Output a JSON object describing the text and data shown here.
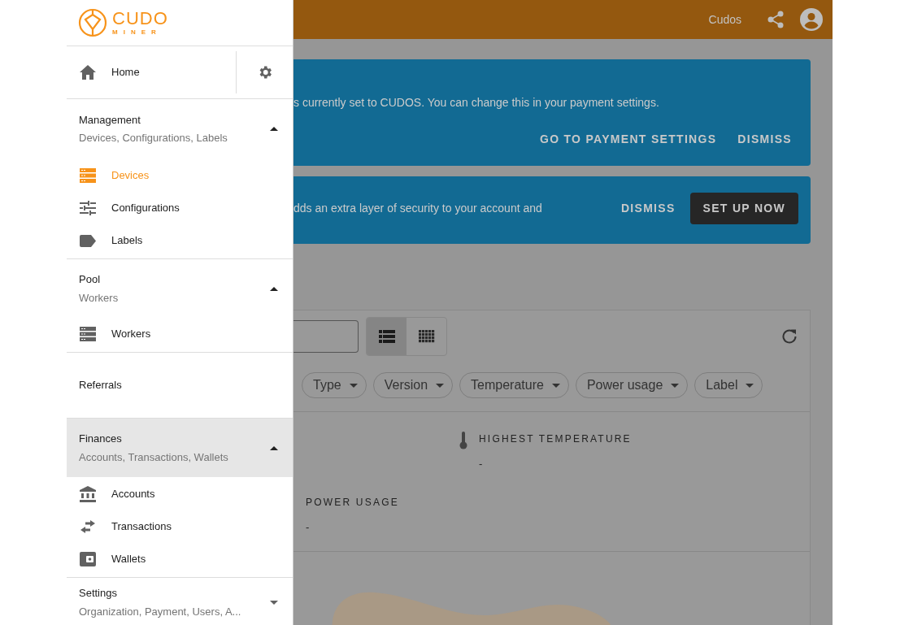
{
  "drawer": {
    "logo": {
      "name": "CUDO",
      "tagline": "MINER"
    },
    "home": {
      "label": "Home"
    },
    "sections": [
      {
        "title": "Management",
        "subtitle": "Devices, Configurations, Labels",
        "expanded": true,
        "highlighted": false,
        "items": [
          {
            "label": "Devices",
            "kind": "server",
            "selected": true
          },
          {
            "label": "Configurations",
            "kind": "tune",
            "selected": false
          },
          {
            "label": "Labels",
            "kind": "label",
            "selected": false
          }
        ]
      },
      {
        "title": "Pool",
        "subtitle": "Workers",
        "expanded": true,
        "highlighted": false,
        "items": [
          {
            "label": "Workers",
            "kind": "server",
            "selected": false
          }
        ]
      },
      {
        "title": "Referrals",
        "highlighted": false
      },
      {
        "title": "Finances",
        "subtitle": "Accounts, Transactions, Wallets",
        "expanded": true,
        "highlighted": true,
        "items": [
          {
            "label": "Accounts",
            "kind": "bank",
            "selected": false
          },
          {
            "label": "Transactions",
            "kind": "swap",
            "selected": false
          },
          {
            "label": "Wallets",
            "kind": "wallet",
            "selected": false
          }
        ]
      },
      {
        "title": "Settings",
        "subtitle": "Organization, Payment, Users, A...",
        "expanded": false,
        "highlighted": false
      }
    ]
  },
  "main": {
    "topbar": {
      "user": "Cudos"
    },
    "banners": [
      {
        "text": "s currently set to CUDOS. You can change this in your payment settings.",
        "actions": [
          {
            "label": "GO TO PAYMENT SETTINGS",
            "kind": "text"
          },
          {
            "label": "DISMISS",
            "kind": "text"
          }
        ]
      },
      {
        "text": "dds an extra layer of security to your account and",
        "actions": [
          {
            "label": "DISMISS",
            "kind": "text"
          },
          {
            "label": "SET UP NOW",
            "kind": "filled"
          }
        ]
      }
    ],
    "view_toggle": [
      {
        "kind": "list",
        "selected": true
      },
      {
        "kind": "grid",
        "selected": false
      }
    ],
    "filters": [
      "Type",
      "Version",
      "Temperature",
      "Power usage",
      "Label"
    ],
    "stats": [
      {
        "kind": "temperature",
        "label": "HIGHEST TEMPERATURE",
        "value": "-"
      },
      {
        "kind": "power",
        "label": "POWER USAGE",
        "value": "-"
      }
    ]
  }
}
